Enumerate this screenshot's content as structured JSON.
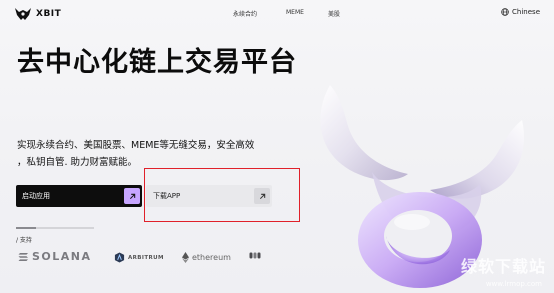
{
  "nav": {
    "brand": "XBIT",
    "links": [
      "永续合约",
      "MEME",
      "美股"
    ],
    "language": "Chinese"
  },
  "hero": {
    "title": "去中心化链上交易平台",
    "subtitle_line1": "实现永续合约、美国股票、MEME等无缝交易，安全高效",
    "subtitle_line2": "，私钥自管. 助力财富赋能。"
  },
  "buttons": {
    "launch": "启动应用",
    "download": "下载APP"
  },
  "support": {
    "label": "/ 支持",
    "chains": [
      "SOLANA",
      "ARBITRUM",
      "ethereum"
    ]
  },
  "watermark": {
    "text": "绿软下载站",
    "url": "www.lrmop.com"
  },
  "colors": {
    "accent": "#c7a6ff",
    "highlight_border": "#e0202a",
    "dark_button": "#0d0d0d"
  }
}
